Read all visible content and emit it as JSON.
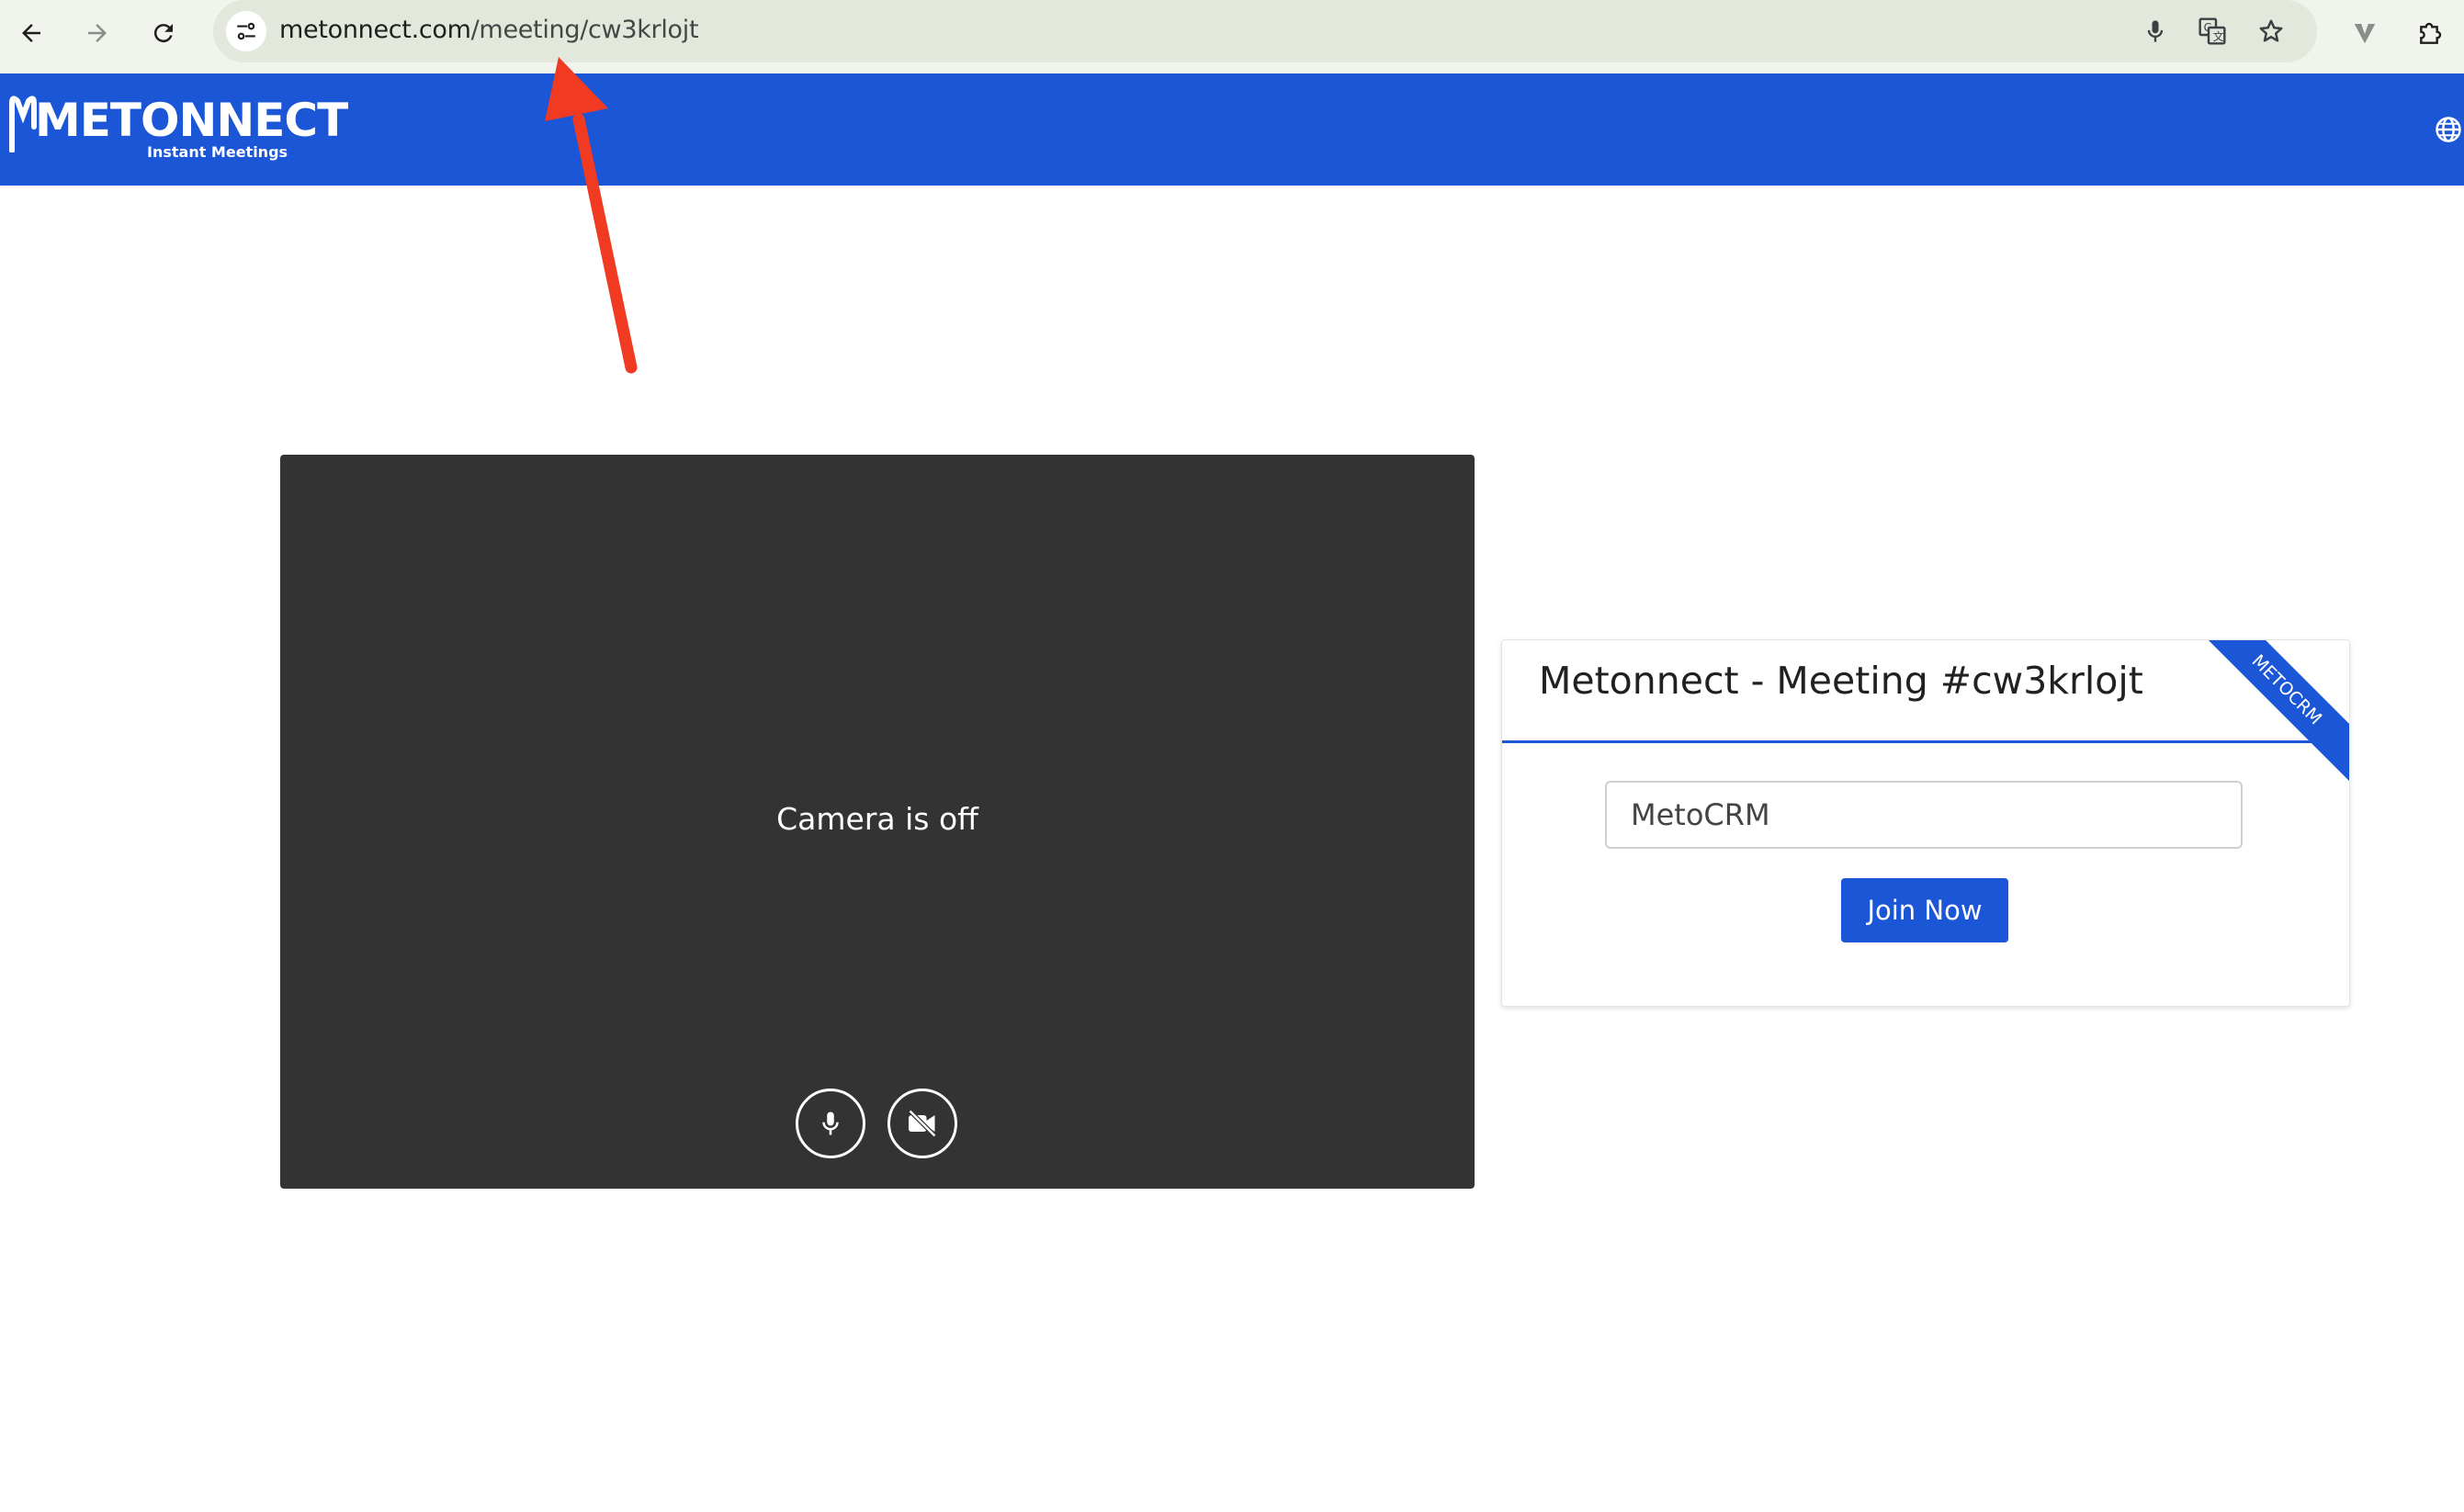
{
  "browser": {
    "url_domain": "metonnect.com",
    "url_path": "/meeting/cw3krlojt"
  },
  "header": {
    "logo_title": "METONNECT",
    "logo_subtitle": "Instant Meetings"
  },
  "video": {
    "status_text": "Camera is off"
  },
  "join_card": {
    "title": "Metonnect - Meeting #cw3krlojt",
    "ribbon_label": "METOCRM",
    "name_value": "MetoCRM",
    "join_label": "Join Now"
  },
  "colors": {
    "brand_blue": "#1a56d6",
    "video_background": "#333333",
    "annotation_arrow": "#f03a22"
  }
}
